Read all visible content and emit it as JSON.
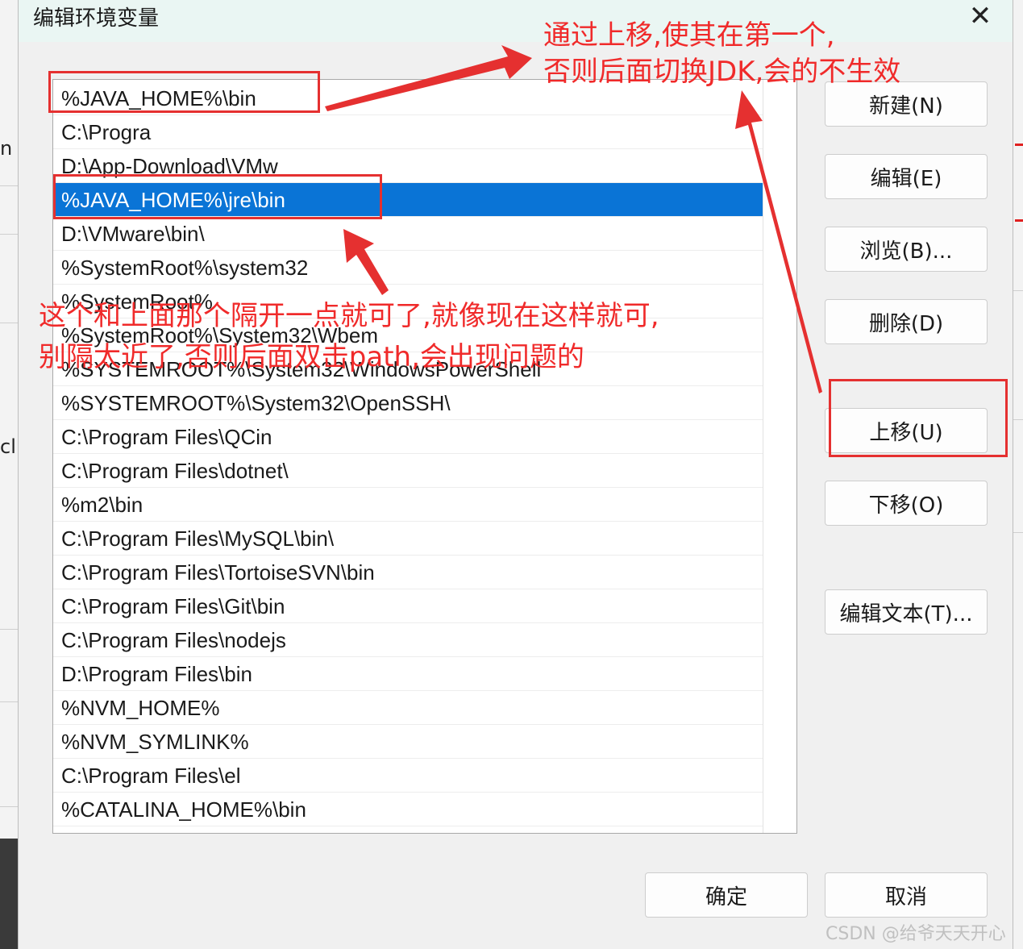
{
  "dialog": {
    "title": "编辑环境变量",
    "close_glyph": "✕"
  },
  "path_list": {
    "selected_index": 3,
    "items": [
      "%JAVA_HOME%\\bin",
      "C:\\Progra",
      "D:\\App-Download\\VMw",
      "%JAVA_HOME%\\jre\\bin",
      "D:\\VMware\\bin\\",
      "%SystemRoot%\\system32",
      "%SystemRoot%",
      "%SystemRoot%\\System32\\Wbem",
      "%SYSTEMROOT%\\System32\\WindowsPowerShell",
      "%SYSTEMROOT%\\System32\\OpenSSH\\",
      "C:\\Program Files\\QCin",
      "C:\\Program Files\\dotnet\\",
      "%m2\\bin",
      "C:\\Program Files\\MySQL\\bin\\",
      "C:\\Program Files\\TortoiseSVN\\bin",
      "C:\\Program Files\\Git\\bin",
      "C:\\Program Files\\nodejs",
      "D:\\Program Files\\bin",
      "%NVM_HOME%",
      "%NVM_SYMLINK%",
      "C:\\Program Files\\el",
      "%CATALINA_HOME%\\bin"
    ]
  },
  "buttons": {
    "new": "新建(N)",
    "edit": "编辑(E)",
    "browse": "浏览(B)...",
    "delete": "删除(D)",
    "move_up": "上移(U)",
    "move_down": "下移(O)",
    "edit_text": "编辑文本(T)...",
    "ok": "确定",
    "cancel": "取消"
  },
  "annotations": {
    "top_note_line1": "通过上移,使其在第一个,",
    "top_note_line2": "否则后面切换JDK,会的不生效",
    "mid_note_line1": "这个和上面那个隔开一点就可了,就像现在这样就可,",
    "mid_note_line2": "别隔太近了,否则后面双击path,会出现问题的",
    "color": "#e53030"
  },
  "watermark": "CSDN @给爷天天开心",
  "colors": {
    "selection": "#0a74d6",
    "titlebar": "#eaf6f3",
    "annotation_red": "#e53030"
  }
}
